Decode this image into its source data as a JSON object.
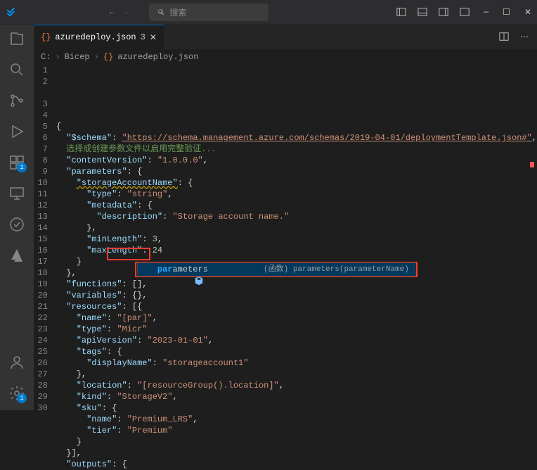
{
  "titleBar": {
    "searchPlaceholder": "搜索"
  },
  "tab": {
    "icon": "{}",
    "name": "azuredeploy.json",
    "modified": "3"
  },
  "breadcrumb": {
    "parts": [
      "C:",
      "Bicep",
      "azuredeploy.json"
    ]
  },
  "activityBadges": {
    "extensions": "1",
    "settings": "1"
  },
  "intellisense": {
    "matchPrefix": "par",
    "matchRest": "ameters",
    "desc": "(函数) parameters(parameterName)"
  },
  "code": {
    "lines": [
      {
        "n": 1,
        "indent": 0,
        "raw": "{"
      },
      {
        "n": 2,
        "indent": 1,
        "key": "$schema",
        "url": "https://schema.management.azure.com/schemas/2019-04-01/deploymentTemplate.json#",
        "trail": ","
      },
      {
        "n": 0,
        "indent": 1,
        "hint": "选择或创建参数文件以启用完整验证..."
      },
      {
        "n": 3,
        "indent": 1,
        "key": "contentVersion",
        "str": "1.0.0.0",
        "trail": ","
      },
      {
        "n": 4,
        "indent": 1,
        "key": "parameters",
        "after": ": {"
      },
      {
        "n": 5,
        "indent": 2,
        "squiggleKey": "storageAccountName",
        "after": ": {"
      },
      {
        "n": 6,
        "indent": 3,
        "key": "type",
        "str": "string",
        "trail": ","
      },
      {
        "n": 7,
        "indent": 3,
        "key": "metadata",
        "after": ": {"
      },
      {
        "n": 8,
        "indent": 4,
        "key": "description",
        "str": "Storage account name."
      },
      {
        "n": 9,
        "indent": 3,
        "raw": "},"
      },
      {
        "n": 10,
        "indent": 3,
        "key": "minLength",
        "num": "3",
        "trail": ","
      },
      {
        "n": 11,
        "indent": 3,
        "key": "maxLength",
        "num": "24"
      },
      {
        "n": 12,
        "indent": 2,
        "raw": "}"
      },
      {
        "n": 13,
        "indent": 1,
        "raw": "},"
      },
      {
        "n": 14,
        "indent": 1,
        "key": "functions",
        "after": ": [],"
      },
      {
        "n": 15,
        "indent": 1,
        "key": "variables",
        "after": ": {},"
      },
      {
        "n": 16,
        "indent": 1,
        "key": "resources",
        "after": ": [{"
      },
      {
        "n": 17,
        "indent": 2,
        "key": "name",
        "str": "[par]",
        "trail": ","
      },
      {
        "n": 18,
        "indent": 2,
        "key": "type",
        "str": "Micr",
        "cutoff": true
      },
      {
        "n": 19,
        "indent": 2,
        "key": "apiVersion",
        "str": "2023-01-01",
        "trail": ","
      },
      {
        "n": 20,
        "indent": 2,
        "key": "tags",
        "after": ": {"
      },
      {
        "n": 21,
        "indent": 3,
        "key": "displayName",
        "str": "storageaccount1"
      },
      {
        "n": 22,
        "indent": 2,
        "raw": "},"
      },
      {
        "n": 23,
        "indent": 2,
        "key": "location",
        "str": "[resourceGroup().location]",
        "trail": ","
      },
      {
        "n": 24,
        "indent": 2,
        "key": "kind",
        "str": "StorageV2",
        "trail": ","
      },
      {
        "n": 25,
        "indent": 2,
        "key": "sku",
        "after": ": {"
      },
      {
        "n": 26,
        "indent": 3,
        "key": "name",
        "str": "Premium_LRS",
        "trail": ","
      },
      {
        "n": 27,
        "indent": 3,
        "key": "tier",
        "str": "Premium"
      },
      {
        "n": 28,
        "indent": 2,
        "raw": "}"
      },
      {
        "n": 29,
        "indent": 1,
        "raw": "}],"
      },
      {
        "n": 30,
        "indent": 1,
        "key": "outputs",
        "after": ": {"
      }
    ]
  }
}
